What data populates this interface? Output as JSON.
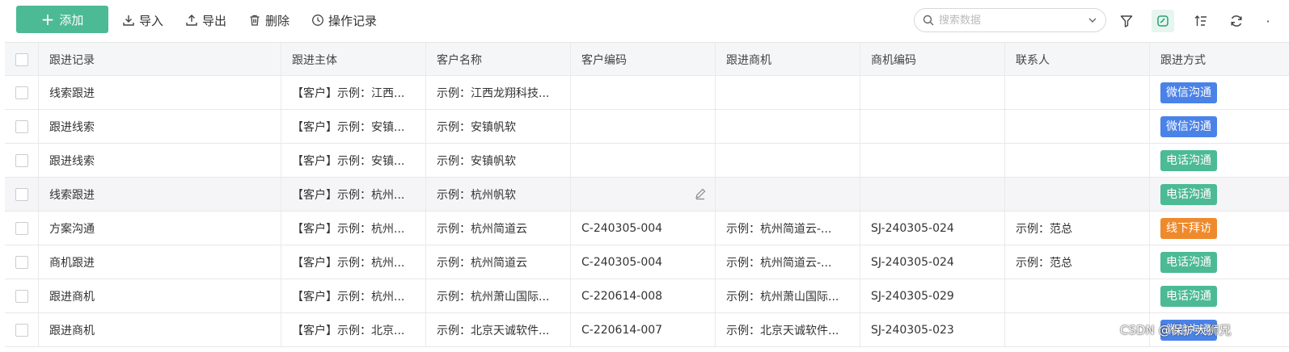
{
  "toolbar": {
    "add_label": "添加",
    "import_label": "导入",
    "export_label": "导出",
    "delete_label": "删除",
    "history_label": "操作记录",
    "search_placeholder": "搜索数据"
  },
  "columns": [
    "跟进记录",
    "跟进主体",
    "客户名称",
    "客户编码",
    "跟进商机",
    "商机编码",
    "联系人",
    "跟进方式"
  ],
  "colors": {
    "accent": "#4cba94",
    "tag_wechat": "#4a82e8",
    "tag_phone": "#4cba94",
    "tag_visit": "#ef8a2c"
  },
  "rows": [
    {
      "record": "线索跟进",
      "subject": "【客户】示例：江西...",
      "customer": "示例：江西龙翔科技...",
      "code": "",
      "opportunity": "",
      "opp_code": "",
      "contact": "",
      "method": "微信沟通",
      "method_color": "#4a82e8"
    },
    {
      "record": "跟进线索",
      "subject": "【客户】示例：安镇...",
      "customer": "示例：安镇帆软",
      "code": "",
      "opportunity": "",
      "opp_code": "",
      "contact": "",
      "method": "微信沟通",
      "method_color": "#4a82e8"
    },
    {
      "record": "跟进线索",
      "subject": "【客户】示例：安镇...",
      "customer": "示例：安镇帆软",
      "code": "",
      "opportunity": "",
      "opp_code": "",
      "contact": "",
      "method": "电话沟通",
      "method_color": "#4cba94"
    },
    {
      "record": "线索跟进",
      "subject": "【客户】示例：杭州...",
      "customer": "示例：杭州帆软",
      "code": "",
      "opportunity": "",
      "opp_code": "",
      "contact": "",
      "method": "电话沟通",
      "method_color": "#4cba94"
    },
    {
      "record": "方案沟通",
      "subject": "【客户】示例：杭州...",
      "customer": "示例：杭州简道云",
      "code": "C-240305-004",
      "opportunity": "示例：杭州简道云-...",
      "opp_code": "SJ-240305-024",
      "contact": "示例：范总",
      "method": "线下拜访",
      "method_color": "#ef8a2c"
    },
    {
      "record": "商机跟进",
      "subject": "【客户】示例：杭州...",
      "customer": "示例：杭州简道云",
      "code": "C-240305-004",
      "opportunity": "示例：杭州简道云-...",
      "opp_code": "SJ-240305-024",
      "contact": "示例：范总",
      "method": "电话沟通",
      "method_color": "#4cba94"
    },
    {
      "record": "跟进商机",
      "subject": "【客户】示例：杭州...",
      "customer": "示例：杭州萧山国际...",
      "code": "C-220614-008",
      "opportunity": "示例：杭州萧山国际...",
      "opp_code": "SJ-240305-029",
      "contact": "",
      "method": "电话沟通",
      "method_color": "#4cba94"
    },
    {
      "record": "跟进商机",
      "subject": "【客户】示例：北京...",
      "customer": "示例：北京天诚软件...",
      "code": "C-220614-007",
      "opportunity": "示例：北京天诚软件...",
      "opp_code": "SJ-240305-023",
      "contact": "",
      "method": "微信沟通",
      "method_color": "#4a82e8"
    }
  ],
  "watermark": "CSDN @保护大狮兄"
}
